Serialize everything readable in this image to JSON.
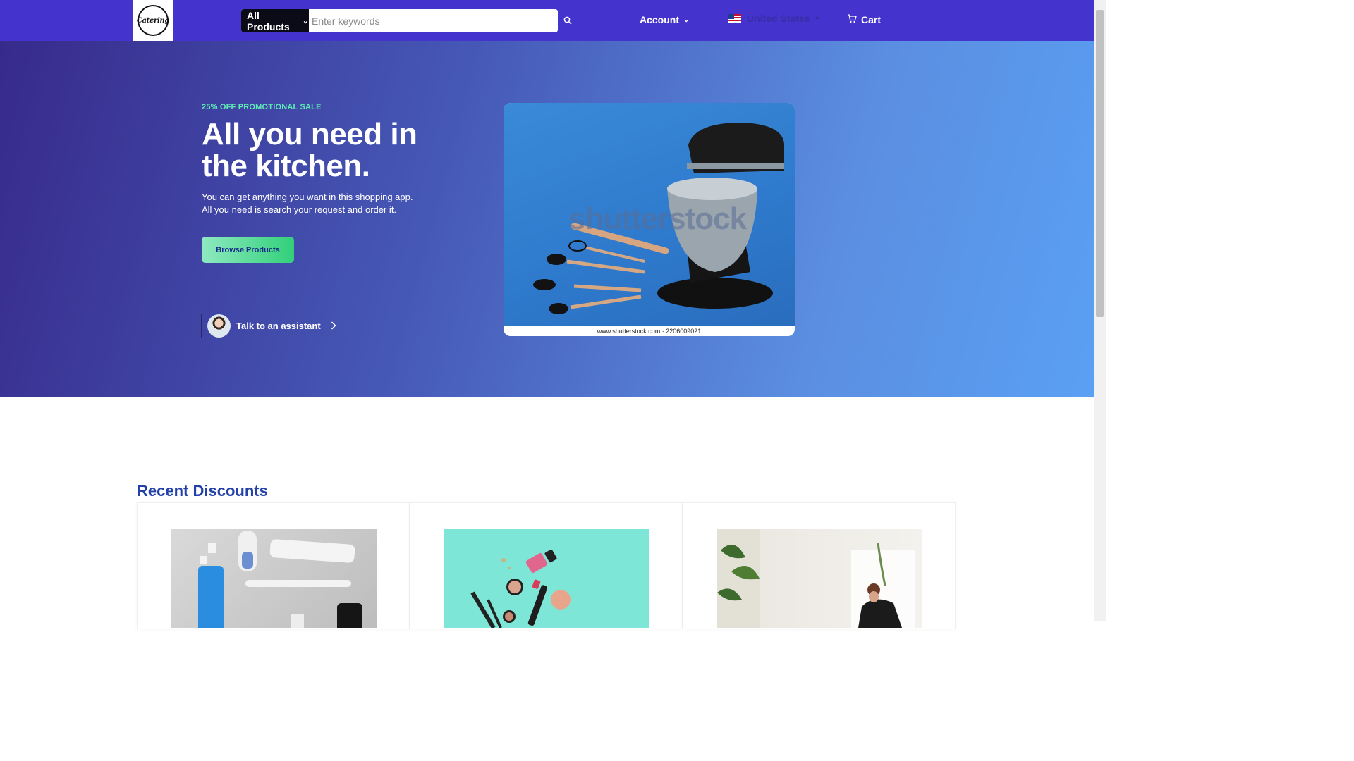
{
  "header": {
    "logo_text": "Catering",
    "search_category": "All Products",
    "search_placeholder": "Enter keywords",
    "account_label": "Account",
    "country_label": "United States",
    "cart_label": "Cart"
  },
  "hero": {
    "promo": "25% OFF PROMOTIONAL SALE",
    "headline_line1": "All you need in",
    "headline_line2": "the kitchen.",
    "subtitle_line1": "You can get anything you want in this shopping app.",
    "subtitle_line2": "All you need is search your request and order it.",
    "browse_button": "Browse Products",
    "assistant_label": "Talk to an assistant",
    "image_caption": "www.shutterstock.com · 2206009021",
    "watermark": "shutterstock"
  },
  "discounts": {
    "title": "Recent Discounts"
  },
  "colors": {
    "navbar": "#4433cc",
    "hero_start": "#372a8c",
    "hero_end": "#5aa0f4",
    "accent_green": "#31d07a",
    "section_title": "#2341a8"
  },
  "icons": [
    "logo-icon",
    "chevron-down-icon",
    "search-icon",
    "us-flag-icon",
    "cart-icon",
    "chevron-right-icon"
  ]
}
